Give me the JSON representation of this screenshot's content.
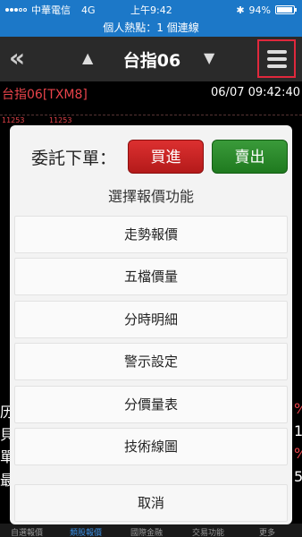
{
  "status_bar": {
    "carrier": "中華電信",
    "network": "4G",
    "time": "上午9:42",
    "battery": "94%",
    "battery_level": 0.94
  },
  "connection": "個人熱點：1 個連線",
  "header": {
    "back_icon": "double-chevron-left-icon",
    "title": "台指06",
    "menu_icon": "hamburger-icon"
  },
  "quote": {
    "symbol": "台指06[TXM8]",
    "datetime": "06/07 09:42:40",
    "price_label": "11253"
  },
  "modal": {
    "order_label": "委託下單：",
    "buy_label": "買進",
    "sell_label": "賣出",
    "subtitle": "選擇報價功能",
    "options": [
      "走勢報價",
      "五檔價量",
      "分時明細",
      "警示設定",
      "分價量表",
      "技術線圖"
    ],
    "cancel": "取消"
  },
  "tabs": [
    "自選報價",
    "類股報價",
    "國際金融",
    "交易功能",
    "更多"
  ],
  "colors": {
    "status_blue": "#1c78c8",
    "alert_red": "#e0283c",
    "buy_red": "#c82222",
    "sell_green": "#2a8a2a",
    "symbol_red": "#e8434a"
  }
}
